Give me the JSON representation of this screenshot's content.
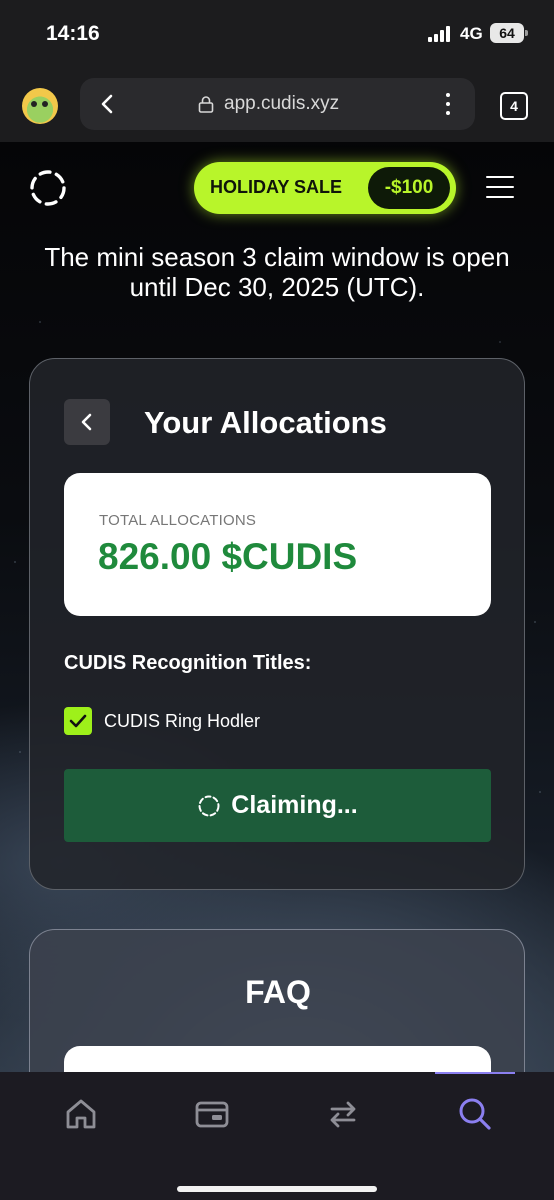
{
  "status_bar": {
    "time": "14:16",
    "network": "4G",
    "battery": "64"
  },
  "browser": {
    "url": "app.cudis.xyz",
    "tab_count": "4",
    "icons": [
      "back-arrow-icon",
      "lock-icon",
      "more-vertical-icon",
      "tabs-icon"
    ]
  },
  "header": {
    "sale_label": "HOLIDAY SALE",
    "sale_discount": "-$100",
    "accent_color": "#b8f52a"
  },
  "notice": "The mini season 3 claim window is open until Dec 30, 2025 (UTC).",
  "allocations": {
    "title": "Your Allocations",
    "total_label": "TOTAL ALLOCATIONS",
    "total_value": "826.00 $CUDIS",
    "value_color": "#1f8a3c",
    "recognition_heading": "CUDIS Recognition Titles:",
    "titles": [
      {
        "label": "CUDIS Ring Hodler",
        "checked": true
      }
    ],
    "claim_button": "Claiming...",
    "claim_color": "#1d5c3a"
  },
  "faq": {
    "title": "FAQ"
  },
  "tab_bar": {
    "items": [
      "home-icon",
      "wallet-icon",
      "swap-icon",
      "search-icon"
    ],
    "active": "search-icon",
    "active_color": "#8b7ff0"
  }
}
